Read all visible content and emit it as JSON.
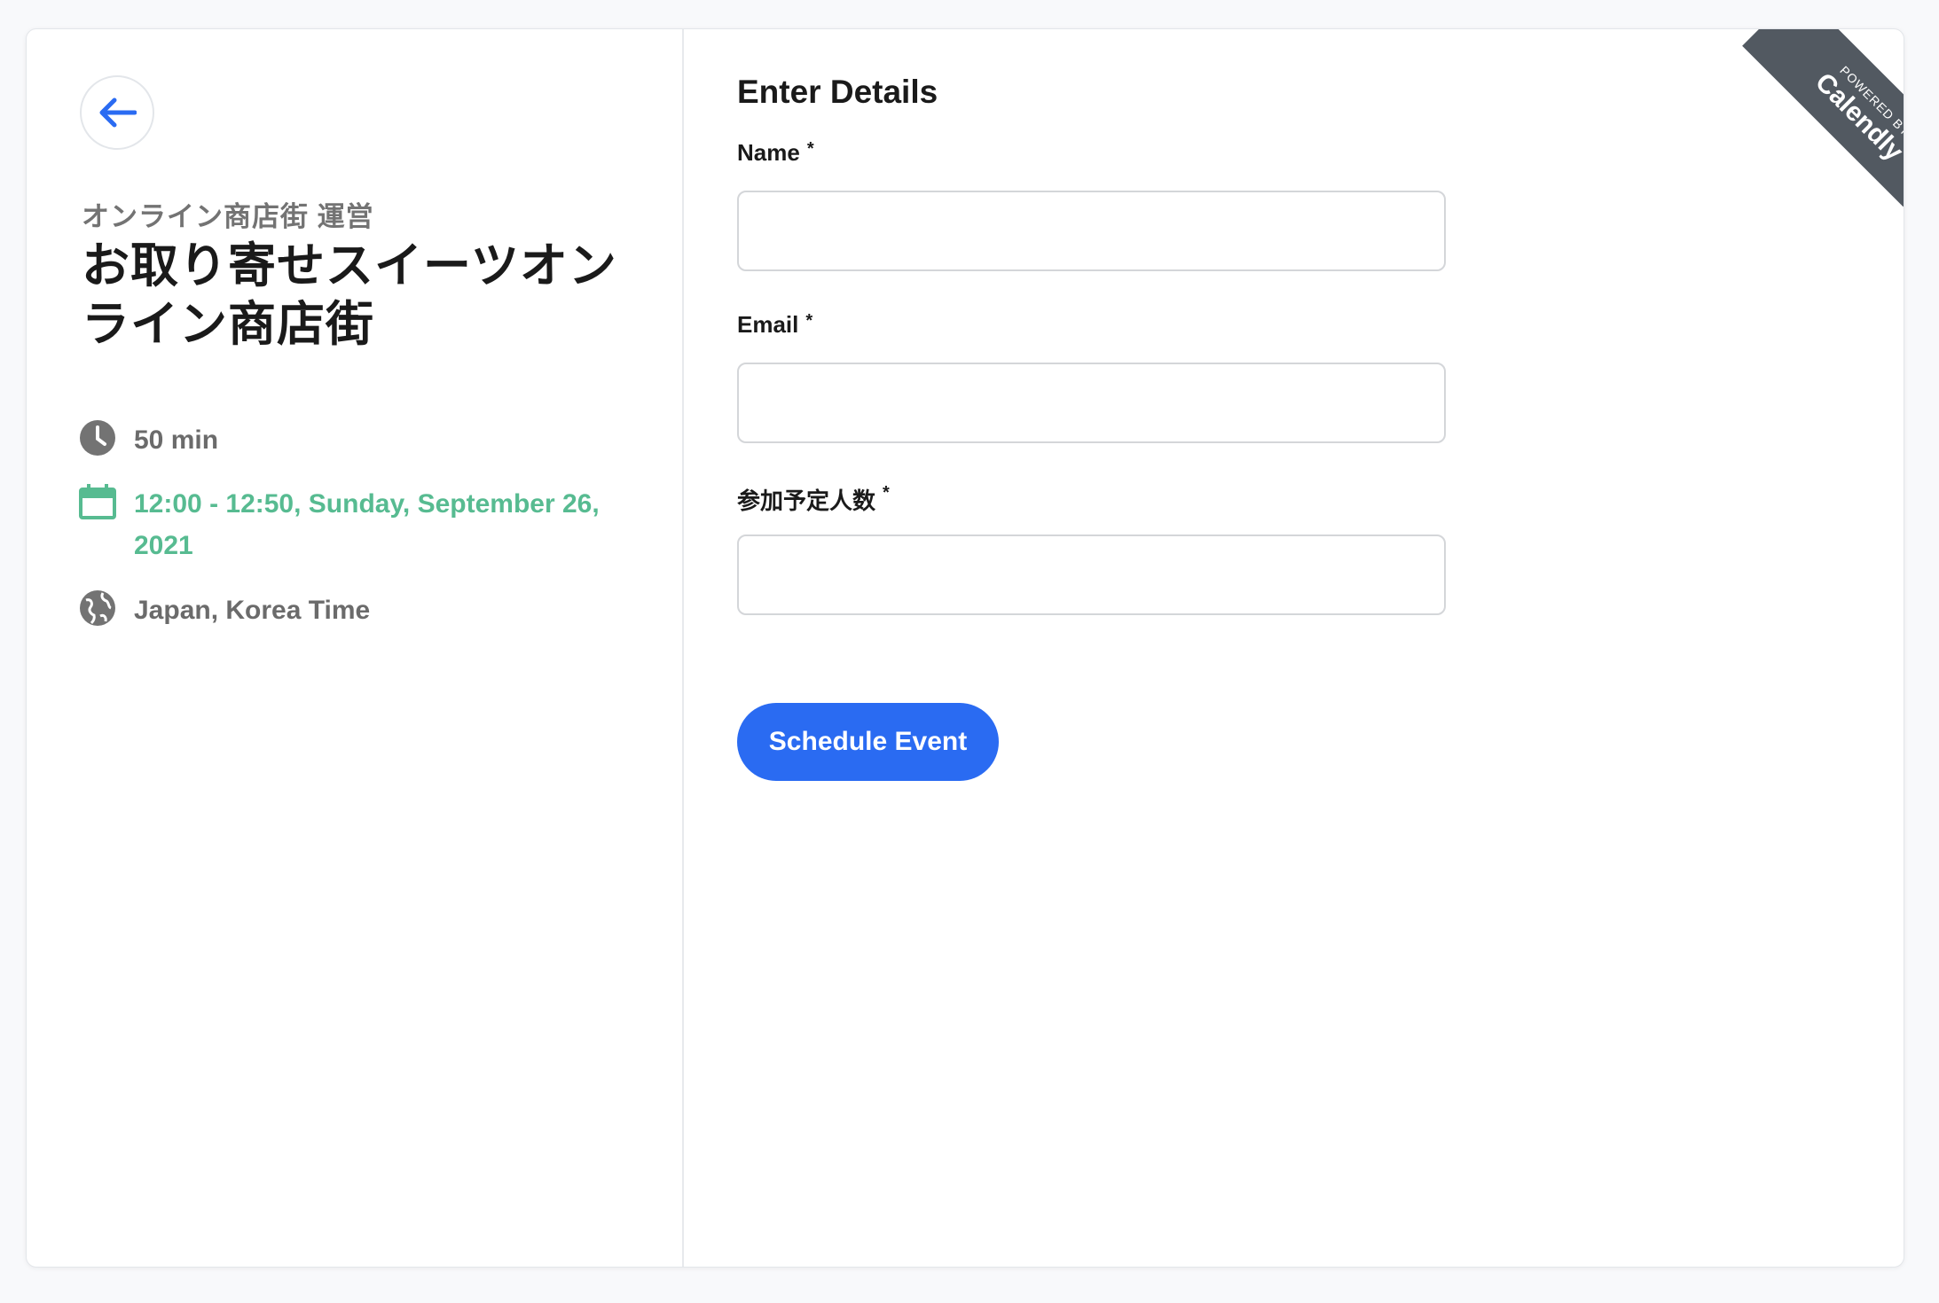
{
  "event": {
    "organizer": "オンライン商店街 運営",
    "title": "お取り寄せスイーツオンライン商店街",
    "duration": "50 min",
    "datetime": "12:00 - 12:50, Sunday, September 26, 2021",
    "timezone": "Japan, Korea Time"
  },
  "form": {
    "title": "Enter Details",
    "fields": [
      {
        "label": "Name",
        "required_mark": "*",
        "value": ""
      },
      {
        "label": "Email",
        "required_mark": "*",
        "value": ""
      },
      {
        "label": "参加予定人数",
        "required_mark": "*",
        "value": ""
      }
    ],
    "submit_label": "Schedule Event"
  },
  "badge": {
    "powered_by": "POWERED BY",
    "brand": "Calendly"
  },
  "colors": {
    "accent": "#2a6bf2",
    "datetime_green": "#57bb91",
    "badge_bg": "#525961"
  },
  "icons": {
    "back": "arrow-left-icon",
    "duration": "clock-icon",
    "datetime": "calendar-icon",
    "timezone": "globe-icon"
  }
}
